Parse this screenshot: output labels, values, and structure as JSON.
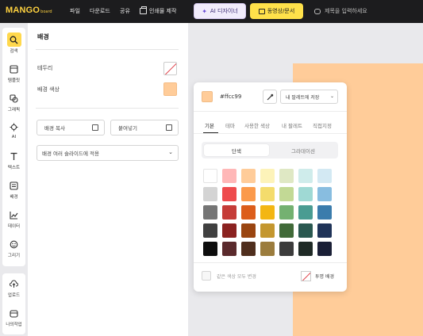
{
  "topbar": {
    "logo_main": "MANGO",
    "logo_sub": "board",
    "menu": [
      "파일",
      "다운로드",
      "공유"
    ],
    "print_label": "인쇄물 제작",
    "ai_label": "AI 디자이너",
    "video_label": "동영상/문서",
    "title_placeholder": "제목을 입력하세요"
  },
  "leftnav": {
    "items": [
      {
        "label": "검색",
        "icon": "search-icon"
      },
      {
        "label": "템플릿",
        "icon": "template-icon"
      },
      {
        "label": "그래픽",
        "icon": "graphic-icon"
      },
      {
        "label": "AI",
        "icon": "ai-icon"
      },
      {
        "label": "텍스트",
        "icon": "text-icon"
      },
      {
        "label": "배경",
        "icon": "background-icon"
      },
      {
        "label": "데이터",
        "icon": "chart-icon"
      },
      {
        "label": "그리기",
        "icon": "draw-icon"
      }
    ],
    "bottom_items": [
      {
        "label": "업로드",
        "icon": "upload-icon"
      },
      {
        "label": "나의작업",
        "icon": "my-work-icon"
      }
    ]
  },
  "panel": {
    "title": "배경",
    "border_label": "테두리",
    "bg_color_label": "배경 색상",
    "copy_label": "배경 복사",
    "paste_label": "붙여넣기",
    "apply_label": "배경 여러 슬라이드에 적용"
  },
  "picker": {
    "hex": "#ffcc99",
    "palette_label": "내 팔레트에 저장",
    "tabs": [
      "기본",
      "테마",
      "사용한 색상",
      "내 팔레트",
      "직접지정"
    ],
    "seg_solid": "단색",
    "seg_gradient": "그라데이션",
    "apply_same_label": "같은 색상 모두 변경",
    "transparent_label": "투명 배경",
    "colors": [
      [
        "#ffffff",
        "#ffb7b7",
        "#ffcc99",
        "#fdf3b9",
        "#dfe8c4",
        "#cfeceb",
        "#d3e9f3",
        "#ece5ee"
      ],
      [
        "#d4d4d4",
        "#ee4b4d",
        "#fb9a4b",
        "#f4dc6c",
        "#c2d995",
        "#9fd9d4",
        "#88bde0",
        "#b790bb"
      ],
      [
        "#757575",
        "#c53c38",
        "#dc5d1b",
        "#f3b613",
        "#74b171",
        "#4a9c92",
        "#3b7cac",
        "#5f4781"
      ],
      [
        "#404040",
        "#8b2220",
        "#9a4510",
        "#c4972f",
        "#416a39",
        "#2a5850",
        "#1f3358",
        "#4a3a6b"
      ],
      [
        "#0d0d0d",
        "#5a2a2c",
        "#4f2e1d",
        "#9b7c3d",
        "#3c3c3c",
        "#1f2a26",
        "#1a1f36",
        "#2c2648"
      ]
    ]
  },
  "canvas": {
    "bg_color": "#ffcc99"
  }
}
